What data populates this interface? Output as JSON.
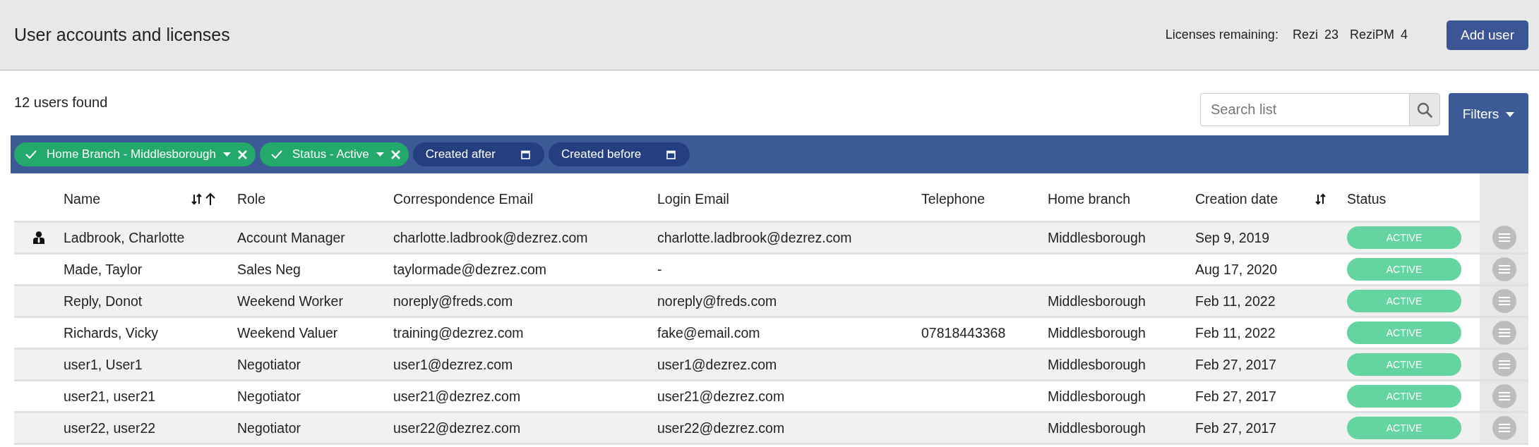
{
  "header": {
    "title": "User accounts and licenses",
    "licenses_label": "Licenses remaining:",
    "licenses": [
      {
        "product": "Rezi",
        "count": "23"
      },
      {
        "product": "ReziPM",
        "count": "4"
      }
    ],
    "add_button": "Add user"
  },
  "toolbar": {
    "results": "12 users found",
    "search": {
      "placeholder": "Search list"
    },
    "filters_button": "Filters"
  },
  "filter_chips": [
    {
      "kind": "filter",
      "label": "Home Branch - Middlesborough"
    },
    {
      "kind": "filter",
      "label": "Status - Active"
    },
    {
      "kind": "date",
      "label": "Created after"
    },
    {
      "kind": "date",
      "label": "Created before"
    }
  ],
  "table": {
    "columns": [
      {
        "label": "Name",
        "sortable": true,
        "sorted_ascending": true
      },
      {
        "label": "Role",
        "sortable": false,
        "sorted_ascending": false
      },
      {
        "label": "Correspondence Email",
        "sortable": false,
        "sorted_ascending": false
      },
      {
        "label": "Login Email",
        "sortable": false,
        "sorted_ascending": false
      },
      {
        "label": "Telephone",
        "sortable": false,
        "sorted_ascending": false
      },
      {
        "label": "Home branch",
        "sortable": false,
        "sorted_ascending": false
      },
      {
        "label": "Creation date",
        "sortable": true,
        "sorted_ascending": false
      },
      {
        "label": "Status",
        "sortable": false,
        "sorted_ascending": false
      }
    ],
    "rows": [
      {
        "user_icon": true,
        "cells": [
          "Ladbrook, Charlotte",
          "Account Manager",
          "charlotte.ladbrook@dezrez.com",
          "charlotte.ladbrook@dezrez.com",
          "",
          "Middlesborough",
          "Sep 9, 2019"
        ],
        "status": "ACTIVE"
      },
      {
        "user_icon": false,
        "cells": [
          "Made, Taylor",
          "Sales Neg",
          "taylormade@dezrez.com",
          "-",
          "",
          "",
          "Aug 17, 2020"
        ],
        "status": "ACTIVE"
      },
      {
        "user_icon": false,
        "cells": [
          "Reply, Donot",
          "Weekend Worker",
          "noreply@freds.com",
          "noreply@freds.com",
          "",
          "Middlesborough",
          "Feb 11, 2022"
        ],
        "status": "ACTIVE"
      },
      {
        "user_icon": false,
        "cells": [
          "Richards, Vicky",
          "Weekend Valuer",
          "training@dezrez.com",
          "fake@email.com",
          "07818443368",
          "Middlesborough",
          "Feb 11, 2022"
        ],
        "status": "ACTIVE"
      },
      {
        "user_icon": false,
        "cells": [
          "user1, User1",
          "Negotiator",
          "user1@dezrez.com",
          "user1@dezrez.com",
          "",
          "Middlesborough",
          "Feb 27, 2017"
        ],
        "status": "ACTIVE"
      },
      {
        "user_icon": false,
        "cells": [
          "user21, user21",
          "Negotiator",
          "user21@dezrez.com",
          "user21@dezrez.com",
          "",
          "Middlesborough",
          "Feb 27, 2017"
        ],
        "status": "ACTIVE"
      },
      {
        "user_icon": false,
        "cells": [
          "user22, user22",
          "Negotiator",
          "user22@dezrez.com",
          "user22@dezrez.com",
          "",
          "Middlesborough",
          "Feb 27, 2017"
        ],
        "status": "ACTIVE"
      }
    ]
  }
}
